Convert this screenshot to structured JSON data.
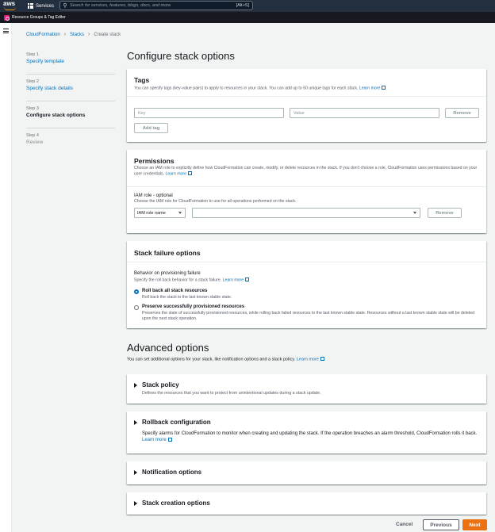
{
  "topnav": {
    "logo": "aws",
    "services_label": "Services",
    "search_placeholder": "Search for services, features, blogs, docs, and more",
    "search_shortcut": "[Alt+S]"
  },
  "subnav": {
    "label": "Resource Groups & Tag Editor"
  },
  "breadcrumb": {
    "items": [
      "CloudFormation",
      "Stacks",
      "Create stack"
    ]
  },
  "steps": [
    {
      "num": "Step 1",
      "title": "Specify template"
    },
    {
      "num": "Step 2",
      "title": "Specify stack details"
    },
    {
      "num": "Step 3",
      "title": "Configure stack options"
    },
    {
      "num": "Step 4",
      "title": "Review"
    }
  ],
  "page_title": "Configure stack options",
  "tags": {
    "title": "Tags",
    "desc": "You can specify tags (key-value pairs) to apply to resources in your stack. You can add up to 50 unique tags for each stack.",
    "learn_more": "Learn more",
    "key_placeholder": "Key",
    "value_placeholder": "Value",
    "remove": "Remove",
    "add_tag": "Add tag"
  },
  "permissions": {
    "title": "Permissions",
    "desc": "Choose an IAM role to explicitly define how CloudFormation can create, modify, or delete resources in the stack. If you don't choose a role, CloudFormation uses permissions based on your user credentials.",
    "learn_more": "Learn more",
    "iam_label": "IAM role - optional",
    "iam_desc": "Choose the IAM role for CloudFormation to use for all operations performed on the stack.",
    "select_value": "IAM role name",
    "remove": "Remove"
  },
  "stack_failure": {
    "title": "Stack failure options",
    "behavior_label": "Behavior on provisioning failure",
    "behavior_desc": "Specify the roll back behavior for a stack failure.",
    "learn_more": "Learn more",
    "option1_label": "Roll back all stack resources",
    "option1_desc": "Roll back the stack to the last known stable state.",
    "option2_label": "Preserve successfully provisioned resources",
    "option2_desc": "Preserves the state of successfully provisioned resources, while rolling back failed resources to the last known stable state. Resources without a last known stable state will be deleted upon the next stack operation."
  },
  "advanced": {
    "title": "Advanced options",
    "desc": "You can set additional options for your stack, like notification options and a stack policy.",
    "learn_more": "Learn more",
    "stack_policy_title": "Stack policy",
    "stack_policy_desc": "Defines the resources that you want to protect from unintentional updates during a stack update.",
    "rollback_title": "Rollback configuration",
    "rollback_desc": "Specify alarms for CloudFormation to monitor when creating and updating the stack. If the operation breaches an alarm threshold, CloudFormation rolls it back.",
    "rollback_learn_more": "Learn more",
    "notification_title": "Notification options",
    "creation_title": "Stack creation options"
  },
  "footer": {
    "cancel": "Cancel",
    "previous": "Previous",
    "next": "Next"
  },
  "colors": {
    "accent": "#0073bb",
    "primary_button": "#ec7211",
    "topnav": "#232f3e"
  }
}
